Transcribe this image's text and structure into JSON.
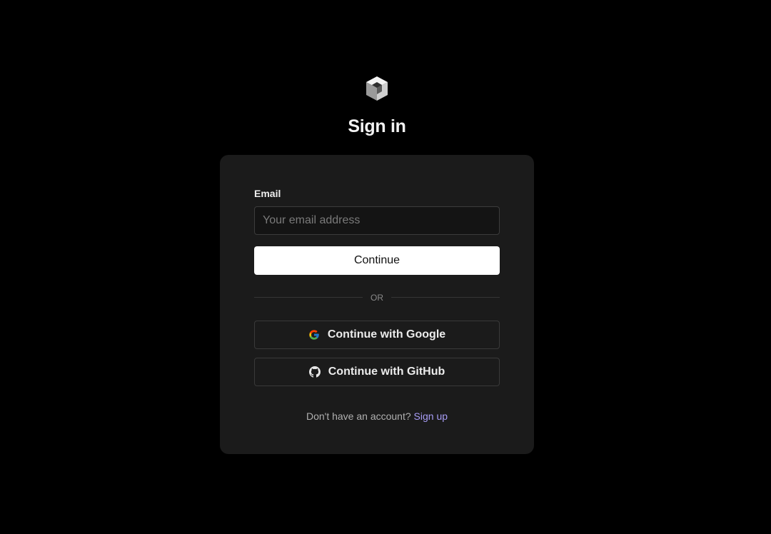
{
  "logo": {
    "icon": "cube-logo-icon"
  },
  "page_title": "Sign in",
  "form": {
    "email_label": "Email",
    "email_placeholder": "Your email address",
    "email_value": "",
    "continue_label": "Continue",
    "divider_text": "OR"
  },
  "oauth": {
    "google_label": "Continue with Google",
    "google_icon": "google-icon",
    "github_label": "Continue with GitHub",
    "github_icon": "github-icon"
  },
  "footer": {
    "prompt": "Don't have an account?",
    "signup_label": "Sign up"
  },
  "colors": {
    "background": "#000000",
    "card": "#1b1b1b",
    "primary_button": "#ffffff",
    "link": "#a79cf5"
  }
}
